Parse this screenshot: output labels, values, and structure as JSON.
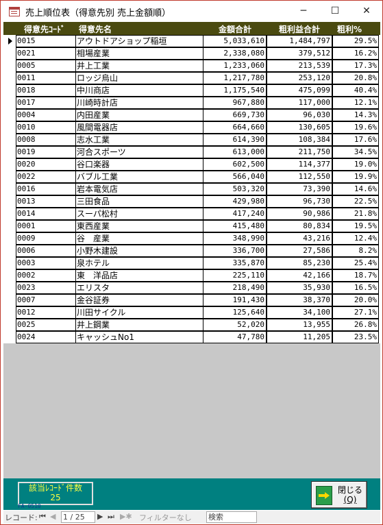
{
  "window": {
    "title": "売上順位表（得意先別 売上金額順）",
    "min_glyph": "─",
    "max_glyph": "☐",
    "close_glyph": "✕"
  },
  "columns": {
    "code": "得意先ｺｰﾄﾞ",
    "name": "得意先名",
    "amount": "金額合計",
    "profit": "粗利益合計",
    "rate": "粗利%"
  },
  "rows": [
    {
      "code": "0015",
      "name": "アウトドアショップ稲垣",
      "amount": "5,033,610",
      "profit": "1,484,797",
      "rate": "29.5%"
    },
    {
      "code": "0021",
      "name": "相場産業",
      "amount": "2,338,080",
      "profit": "379,512",
      "rate": "16.2%"
    },
    {
      "code": "0005",
      "name": "井上工業",
      "amount": "1,233,060",
      "profit": "213,539",
      "rate": "17.3%"
    },
    {
      "code": "0011",
      "name": "ロッジ烏山",
      "amount": "1,217,780",
      "profit": "253,120",
      "rate": "20.8%"
    },
    {
      "code": "0018",
      "name": "中川商店",
      "amount": "1,175,540",
      "profit": "475,099",
      "rate": "40.4%"
    },
    {
      "code": "0017",
      "name": "川崎時計店",
      "amount": "967,880",
      "profit": "117,000",
      "rate": "12.1%"
    },
    {
      "code": "0004",
      "name": "内田産業",
      "amount": "669,730",
      "profit": "96,030",
      "rate": "14.3%"
    },
    {
      "code": "0010",
      "name": "風間電器店",
      "amount": "664,660",
      "profit": "130,605",
      "rate": "19.6%"
    },
    {
      "code": "0008",
      "name": "志水工業",
      "amount": "614,390",
      "profit": "108,384",
      "rate": "17.6%"
    },
    {
      "code": "0019",
      "name": "河合スポーツ",
      "amount": "613,000",
      "profit": "211,750",
      "rate": "34.5%"
    },
    {
      "code": "0020",
      "name": "谷口楽器",
      "amount": "602,500",
      "profit": "114,377",
      "rate": "19.0%"
    },
    {
      "code": "0022",
      "name": "バブル工業",
      "amount": "566,040",
      "profit": "112,550",
      "rate": "19.9%"
    },
    {
      "code": "0016",
      "name": "岩本電気店",
      "amount": "503,320",
      "profit": "73,390",
      "rate": "14.6%"
    },
    {
      "code": "0013",
      "name": "三田食品",
      "amount": "429,980",
      "profit": "96,730",
      "rate": "22.5%"
    },
    {
      "code": "0014",
      "name": "スーパ松村",
      "amount": "417,240",
      "profit": "90,986",
      "rate": "21.8%"
    },
    {
      "code": "0001",
      "name": "東西産業",
      "amount": "415,480",
      "profit": "80,834",
      "rate": "19.5%"
    },
    {
      "code": "0009",
      "name": "谷　産業",
      "amount": "348,990",
      "profit": "43,216",
      "rate": "12.4%"
    },
    {
      "code": "0006",
      "name": "小野木建設",
      "amount": "336,700",
      "profit": "27,586",
      "rate": "8.2%"
    },
    {
      "code": "0003",
      "name": "泉ホテル",
      "amount": "335,870",
      "profit": "85,230",
      "rate": "25.4%"
    },
    {
      "code": "0002",
      "name": "東　洋品店",
      "amount": "225,110",
      "profit": "42,166",
      "rate": "18.7%"
    },
    {
      "code": "0023",
      "name": "エリスタ",
      "amount": "218,490",
      "profit": "35,930",
      "rate": "16.5%"
    },
    {
      "code": "0007",
      "name": "金谷証券",
      "amount": "191,430",
      "profit": "38,370",
      "rate": "20.0%"
    },
    {
      "code": "0012",
      "name": "川田サイクル",
      "amount": "125,640",
      "profit": "34,100",
      "rate": "27.1%"
    },
    {
      "code": "0025",
      "name": "井上鋼業",
      "amount": "52,020",
      "profit": "13,955",
      "rate": "26.8%"
    },
    {
      "code": "0024",
      "name": "キャッシュNo1",
      "amount": "47,780",
      "profit": "11,205",
      "rate": "23.5%"
    }
  ],
  "footer": {
    "count_label": "該当ﾚｺｰﾄﾞ件数",
    "count_value": "25",
    "form_id": "FA-0510",
    "close_label": "閉じる",
    "close_key": "(Q)"
  },
  "nav": {
    "record_label": "レコード:",
    "first": "⏮",
    "prev": "◀",
    "position": "1 / 25",
    "next": "▶",
    "last": "⏭",
    "new": "▶✱",
    "filter": "フィルターなし",
    "search_placeholder": "検索"
  }
}
